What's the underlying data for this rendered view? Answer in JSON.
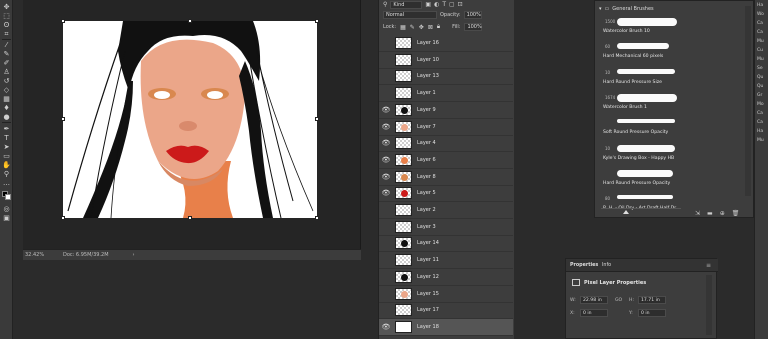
{
  "toolbar": {
    "tools": [
      "move-icon",
      "marquee-icon",
      "lasso-icon",
      "crop-icon",
      "eyedropper-icon",
      "healing-icon",
      "brush-icon",
      "stamp-icon",
      "history-brush-icon",
      "eraser-icon",
      "gradient-icon",
      "blur-icon",
      "dodge-icon",
      "pen-icon",
      "type-icon",
      "path-select-icon",
      "shape-icon",
      "hand-icon",
      "zoom-icon",
      "more-icon"
    ],
    "foreground": "#000000",
    "background": "#ffffff"
  },
  "document": {
    "zoom": "32.42%",
    "doc_info": "Doc: 6.95M/39.2M",
    "arrow": "›"
  },
  "layers": {
    "kind_label": "Kind",
    "blend_mode": "Normal",
    "opacity_label": "Opacity:",
    "opacity_value": "100%",
    "lock_label": "Lock:",
    "fill_label": "Fill:",
    "fill_value": "100%",
    "items": [
      {
        "name": "Layer 16",
        "visible": false
      },
      {
        "name": "Layer 10",
        "visible": false
      },
      {
        "name": "Layer 13",
        "visible": false
      },
      {
        "name": "Layer 1",
        "visible": false
      },
      {
        "name": "Layer 9",
        "visible": true
      },
      {
        "name": "Layer 7",
        "visible": true
      },
      {
        "name": "Layer 4",
        "visible": true
      },
      {
        "name": "Layer 6",
        "visible": true
      },
      {
        "name": "Layer 8",
        "visible": true
      },
      {
        "name": "Layer 5",
        "visible": true
      },
      {
        "name": "Layer 2",
        "visible": false
      },
      {
        "name": "Layer 3",
        "visible": false
      },
      {
        "name": "Layer 14",
        "visible": false
      },
      {
        "name": "Layer 11",
        "visible": false
      },
      {
        "name": "Layer 12",
        "visible": false
      },
      {
        "name": "Layer 15",
        "visible": false
      },
      {
        "name": "Layer 17",
        "visible": false
      },
      {
        "name": "Layer 18",
        "visible": true,
        "selected": true
      }
    ]
  },
  "brushes": {
    "group_name": "General Brushes",
    "items": [
      {
        "size": "1500",
        "name": "Watercolor Brush 10"
      },
      {
        "size": "60",
        "name": "Hard Mechanical 60 pixels"
      },
      {
        "size": "10",
        "name": "Hard Round Pressure Size"
      },
      {
        "size": "1674",
        "name": "Watercolor Brush 1"
      },
      {
        "size": "",
        "name": "Soft Round Pressure Opacity"
      },
      {
        "size": "10",
        "name": "Kyle's Drawing Box - Happy HB"
      },
      {
        "size": "",
        "name": "Hard Round Pressure Opacity"
      },
      {
        "size": "80",
        "name": "R. H. - Oil Dry - Art Draft Half Dr..."
      }
    ]
  },
  "right_panel": {
    "items": [
      "Ha",
      "Wo",
      "Ca",
      "Ca",
      "Mu",
      "Cu",
      "Mu",
      "Se",
      "Qu",
      "Qu",
      "Gr",
      "Mo",
      "Ca",
      "Ca",
      "Ha",
      "Mu"
    ]
  },
  "properties": {
    "tab_properties": "Properties",
    "tab_info": "Info",
    "section_title": "Pixel Layer Properties",
    "w_label": "W:",
    "w_value": "22.98 in",
    "link_label": "GO",
    "h_label": "H:",
    "h_value": "17.71 in",
    "x_label": "X:",
    "x_value": "0 in",
    "y_label": "Y:",
    "y_value": "0 in"
  }
}
